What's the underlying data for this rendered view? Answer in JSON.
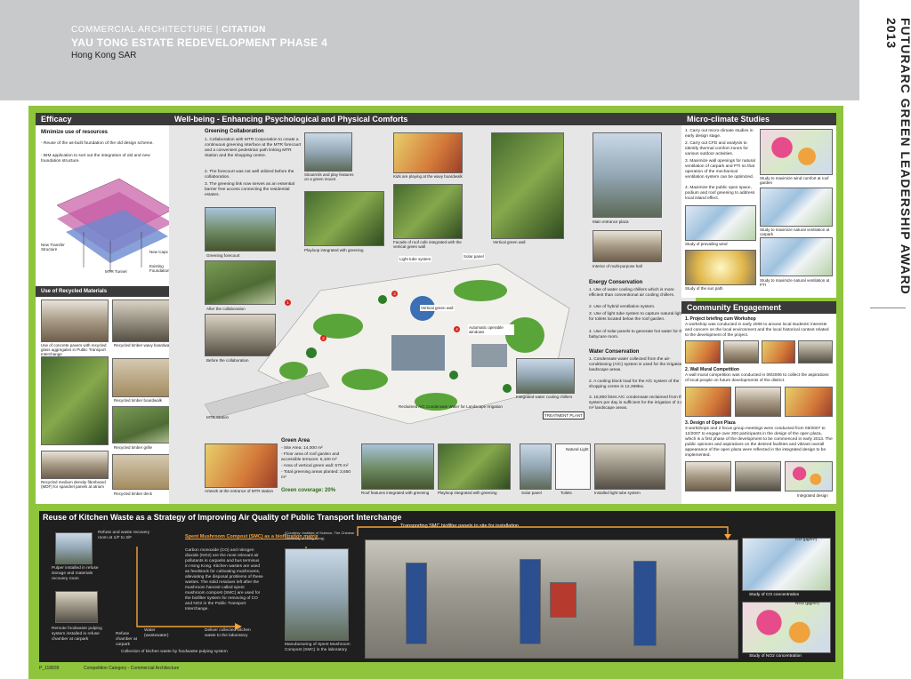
{
  "header": {
    "category": "COMMERCIAL ARCHITECTURE",
    "separator": "|",
    "citation": "CITATION",
    "title": "YAU TONG ESTATE REDEVELOPMENT PHASE 4",
    "location": "Hong Kong SAR"
  },
  "side_label": "FUTURARC GREEN LEADERSHIP AWARD 2013",
  "efficacy": {
    "heading": "Efficacy",
    "sub": "Minimize use of resources",
    "text1": "- Reuse of the as-built foundation of the old design scheme.",
    "text2": "- BIM application to sort out the integration of old and new foundation structure.",
    "labels": [
      "New Transfer Structure",
      "New Caps",
      "MTR Tunnel",
      "Existing Foundation"
    ],
    "recycled_heading": "Use of Recycled Materials",
    "captions": [
      "Use of concrete pavers with recycled glass aggregates in Public Transport Interchange",
      "Recycled timber wavy boardwalk",
      "Recycled timber boardwalk",
      "Recycled timber grille",
      "Recycled medium density fibreboard (MDF) for spandrel panels at atrium",
      "Recycled timber deck"
    ]
  },
  "wellbeing": {
    "heading": "Well-being - Enhancing Psychological and Physical Comforts",
    "greening_sub": "Greening Collaboration",
    "greening_items": [
      "1. Collaboration with MTR Corporation to create a continuous greening interface at the MTR forecourt and a convenient pedestrian path linking MTR Station and the shopping centre.",
      "2. The forecourt was not well utilized before the collaboration.",
      "3. The greening link now serves as an essential barrier free access connecting the residential estates."
    ],
    "photo_caps": [
      "Greening forecourt",
      "After the collaboration",
      "Before the collaboration",
      "Sitoutrnils and play features on a green mount",
      "Playloop integrated with greening",
      "Kids are playing at the wavy boardwalk",
      "Facade of roof cafe integrated with the vertical green wall",
      "Vertical green wall",
      "Main entrance plaza",
      "Interior of multi-purpose hall"
    ],
    "plan_labels": [
      "Light tube system",
      "Solar panel",
      "Vertical green wall",
      "Automatic operable windows",
      "MTR Station",
      "Reclaimed A/C Condensate Water for Landscape Irrigation",
      "Integrated water cooling chillers",
      "TREATMENT PLANT"
    ],
    "energy_sub": "Energy Conservation",
    "energy_items": [
      "1. Use of water cooling chillers which is more efficient than conventional air cooling chillers.",
      "2. Use of hybrid ventilation system.",
      "3. Use of light tube system to capture natural light for toilets located below the roof garden.",
      "4. Use of solar panels to generate hot water for the babycare room."
    ],
    "water_sub": "Water Conservation",
    "water_items": [
      "1. Condensate water collected from the air-conditioning (A/C) system is used for the irrigation of landscape areas.",
      "2. A cooling block load for the A/C system of the shopping centre is 12,369kw.",
      "3. 16,800 litres A/C condensate reclaimed from the system per day is sufficient for the irrigation of 3,500 m² landscape areas."
    ],
    "green_sub": "Green Area",
    "green_items": [
      "- Site Area: 14,000 m²",
      "- Floor area of roof garden and accessible terraces: 6,100 m²",
      "- Area of vertical green wall: 570 m²",
      "- Total greening areas planted: 3,650 m²"
    ],
    "coverage": "Green coverage: 20%",
    "bottom_caps": [
      "Artwork at the entrance of MTR station",
      "Roof features integrated with greening",
      "Playloop integrated with greening",
      "Solar panel",
      "Toilets",
      "Natural Light",
      "Installed light tube system"
    ]
  },
  "micro": {
    "heading": "Micro-climate Studies",
    "items": [
      "1. Carry out micro-climate studies in early design stage.",
      "2. Carry out CFD and analysis to identify thermal comfort zones for various outdoor activities.",
      "3. Maximize wall openings for natural ventilation of carpark and PTI so that operation of the mechanical ventilation system can be optimized.",
      "4. Maximize the public open space, podium and roof greening to address local island effect."
    ],
    "caps": [
      "Study to maximize wind comfort at roof garden",
      "Study of prevailing wind",
      "Study to maximize natural ventilation at carpark",
      "Study of the sun path",
      "Study to maximize natural ventilation at PTI"
    ]
  },
  "community": {
    "heading": "Community Engagement",
    "s1": "1. Project briefing cum Workshop",
    "t1": "A workshop was conducted in early 2006 to arouse local students' interests and concern on the local environment and the local historical context related to the development of the project.",
    "s2": "2. Wall Mural Competition",
    "t2": "A wall mural competition was conducted in 09/2006 to collect the aspirations of local people on future developments of the district.",
    "s3": "3. Design of Open Plaza",
    "t3": "3 workshops and 2 focus group meetings were conducted from 09/2007 to 12/2007 to engage over 300 participants in the design of the open plaza, which is a first phase of the development to be commenced in early 2013. The public opinions and aspirations on the desired facilities and vibrant overall appearance of the open plaza were reflected in the integrated design to be implemented.",
    "cap": "Integrated design"
  },
  "kitchen": {
    "heading": "Reuse of Kitchen Waste as a Strategy of Improving Air Quality of Public Transport Interchange",
    "refuse_room": "Refuse and waste recovery room at 1/F to 3/F",
    "pulper": "Pulper installed in refuse storage and materials recovery room",
    "remote": "Remote foodwaste pulping system installed in refuse chamber at carpark",
    "refuse_chamber": "Refuse chamber at carpark",
    "water_wash": "Water (wastewater)",
    "collection": "Collection of kitchen waste by foodwaste pulping system",
    "deliver": "Deliver collected kitchen waste to the laboratory",
    "smc_title": "Spent Mushroom Compost (SMC) as a biofiltration matrix",
    "smc_text": "Carbon monoxide (CO) and nitrogen dioxide (NO2) are the most relevant air pollutants in carparks and bus terminus in Hong Kong. Kitchen wastes are used as feedstock for cultivating mushrooms, alleviating the disposal problems of these wastes. The solid residues left after the mushroom harvest called spent mushroom compost (SMC) are used for the biofilter system for removing of CO and NO2 in the Public Transport Interchange.",
    "univ": "(Courtesy: Institute of Science, The Chinese University of Hong Kong)",
    "manufacture": "Manufacturing of Spent Mushroom Compost (SMC) in the laboratory",
    "transport": "Transporting SMC biofilter panels to site for installation",
    "co_label": "Study of CO concentration",
    "no_label": "Study of NO2 concentration",
    "co_unit": "CO (μg/m³)",
    "no_unit": "NO2 (μg/m³)"
  },
  "footer": {
    "code": "P_118839",
    "category": "Competition Category - Commercial Architecture"
  }
}
